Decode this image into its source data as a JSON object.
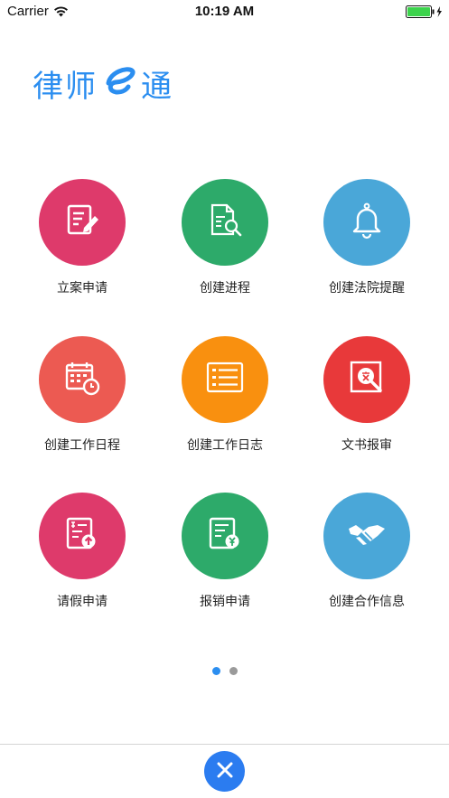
{
  "status_bar": {
    "carrier": "Carrier",
    "time": "10:19 AM",
    "battery_color": "#3cd34c"
  },
  "logo": {
    "text_left": "律师",
    "text_right": "通",
    "color": "#2b8ef0"
  },
  "grid": {
    "items": [
      {
        "label": "立案申请",
        "color": "#de3a6b",
        "icon": "document-edit-icon"
      },
      {
        "label": "创建进程",
        "color": "#2daa6a",
        "icon": "document-search-icon"
      },
      {
        "label": "创建法院提醒",
        "color": "#4aa7d8",
        "icon": "bell-icon"
      },
      {
        "label": "创建工作日程",
        "color": "#ec5a52",
        "icon": "calendar-clock-icon"
      },
      {
        "label": "创建工作日志",
        "color": "#f9900f",
        "icon": "list-icon"
      },
      {
        "label": "文书报审",
        "color": "#e8393a",
        "icon": "document-review-icon"
      },
      {
        "label": "请假申请",
        "color": "#de3a6b",
        "icon": "leave-request-icon"
      },
      {
        "label": "报销申请",
        "color": "#2daa6a",
        "icon": "reimbursement-icon"
      },
      {
        "label": "创建合作信息",
        "color": "#4aa7d8",
        "icon": "handshake-icon"
      }
    ]
  },
  "pagination": {
    "current_page": 1,
    "total_pages": 2
  },
  "bottom": {
    "close_icon": "close-icon",
    "close_color": "#2b7cf0"
  }
}
